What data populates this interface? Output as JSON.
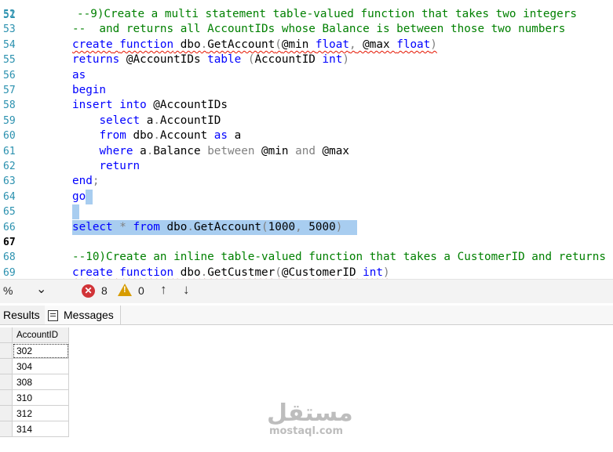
{
  "editor": {
    "lines": [
      {
        "n": "52",
        "parts": [
          [
            "cm",
            "--9)Create a multi statement table-valued function that takes two integers"
          ]
        ]
      },
      {
        "n": "53",
        "parts": [
          [
            "cm",
            "--  and returns all AccountIDs whose Balance is between those two numbers"
          ]
        ]
      },
      {
        "n": "54",
        "parts": [
          [
            "kw",
            "create"
          ],
          [
            "tx",
            " "
          ],
          [
            "kw",
            "function"
          ],
          [
            "tx",
            " dbo"
          ],
          [
            "gr",
            "."
          ],
          [
            "tx",
            "GetAccount"
          ],
          [
            "gr",
            "("
          ],
          [
            "tx",
            "@min "
          ],
          [
            "kw",
            "float"
          ],
          [
            "gr",
            ","
          ],
          [
            "tx",
            " @max "
          ],
          [
            "kw",
            "float"
          ],
          [
            "gr",
            ")"
          ]
        ]
      },
      {
        "n": "55",
        "parts": [
          [
            "kw",
            "returns"
          ],
          [
            "tx",
            " @AccountIDs "
          ],
          [
            "kw",
            "table"
          ],
          [
            "tx",
            " "
          ],
          [
            "gr",
            "("
          ],
          [
            "tx",
            "AccountID "
          ],
          [
            "kw",
            "int"
          ],
          [
            "gr",
            ")"
          ]
        ]
      },
      {
        "n": "56",
        "parts": [
          [
            "kw",
            "as"
          ]
        ]
      },
      {
        "n": "57",
        "parts": [
          [
            "kw",
            "begin"
          ]
        ]
      },
      {
        "n": "58",
        "parts": [
          [
            "kw",
            "insert"
          ],
          [
            "tx",
            " "
          ],
          [
            "kw",
            "into"
          ],
          [
            "tx",
            " @AccountIDs"
          ]
        ]
      },
      {
        "n": "59",
        "parts": [
          [
            "tx",
            "    "
          ],
          [
            "kw",
            "select"
          ],
          [
            "tx",
            " a"
          ],
          [
            "gr",
            "."
          ],
          [
            "tx",
            "AccountID"
          ]
        ]
      },
      {
        "n": "60",
        "parts": [
          [
            "tx",
            "    "
          ],
          [
            "kw",
            "from"
          ],
          [
            "tx",
            " dbo"
          ],
          [
            "gr",
            "."
          ],
          [
            "tx",
            "Account "
          ],
          [
            "kw",
            "as"
          ],
          [
            "tx",
            " a"
          ]
        ]
      },
      {
        "n": "61",
        "parts": [
          [
            "tx",
            "    "
          ],
          [
            "kw",
            "where"
          ],
          [
            "tx",
            " a"
          ],
          [
            "gr",
            "."
          ],
          [
            "tx",
            "Balance "
          ],
          [
            "gr",
            "between"
          ],
          [
            "tx",
            " @min "
          ],
          [
            "gr",
            "and"
          ],
          [
            "tx",
            " @max"
          ]
        ]
      },
      {
        "n": "62",
        "parts": [
          [
            "tx",
            "    "
          ],
          [
            "kw",
            "return"
          ]
        ]
      },
      {
        "n": "63",
        "parts": [
          [
            "kw",
            "end"
          ],
          [
            "gr",
            ";"
          ]
        ]
      },
      {
        "n": "64",
        "parts": [
          [
            "kw",
            "go"
          ]
        ]
      },
      {
        "n": "65",
        "parts": []
      },
      {
        "n": "66",
        "parts": [
          [
            "kw",
            "select"
          ],
          [
            "tx",
            " "
          ],
          [
            "gr",
            "*"
          ],
          [
            "tx",
            " "
          ],
          [
            "kw",
            "from"
          ],
          [
            "tx",
            " dbo"
          ],
          [
            "gr",
            "."
          ],
          [
            "tx",
            "GetAccount"
          ],
          [
            "gr",
            "("
          ],
          [
            "tx",
            "1000"
          ],
          [
            "gr",
            ","
          ],
          [
            "tx",
            " 5000"
          ],
          [
            "gr",
            ")"
          ]
        ]
      },
      {
        "n": "67",
        "parts": []
      },
      {
        "n": "68",
        "parts": [
          [
            "cm",
            "--10)Create an inline table-valued function that takes a CustomerID and returns"
          ]
        ]
      },
      {
        "n": "69",
        "parts": [
          [
            "kw",
            "create"
          ],
          [
            "tx",
            " "
          ],
          [
            "kw",
            "function"
          ],
          [
            "tx",
            " dbo"
          ],
          [
            "gr",
            "."
          ],
          [
            "tx",
            "GetCustmer"
          ],
          [
            "gr",
            "("
          ],
          [
            "tx",
            "@CustomerID "
          ],
          [
            "kw",
            "int"
          ],
          [
            "gr",
            ")"
          ]
        ]
      }
    ],
    "current_line": "67",
    "top_partial_line": "51"
  },
  "toolbar": {
    "zoom": "%",
    "errors": "8",
    "warnings": "0",
    "error_icon": "error-circle-icon",
    "warning_icon": "warning-triangle-icon"
  },
  "tabs": {
    "results": "Results",
    "messages": "Messages"
  },
  "grid": {
    "column": "AccountID",
    "rows": [
      "302",
      "304",
      "308",
      "310",
      "312",
      "314"
    ]
  },
  "watermark": {
    "arabic": "مستقل",
    "latin": "mostaql.com"
  },
  "colors": {
    "keyword": "#0000ff",
    "comment": "#008000",
    "operator": "#808080",
    "line_number": "#2b91af",
    "selection": "#a8cdf0",
    "error": "#d13438",
    "warning": "#d79c00"
  }
}
